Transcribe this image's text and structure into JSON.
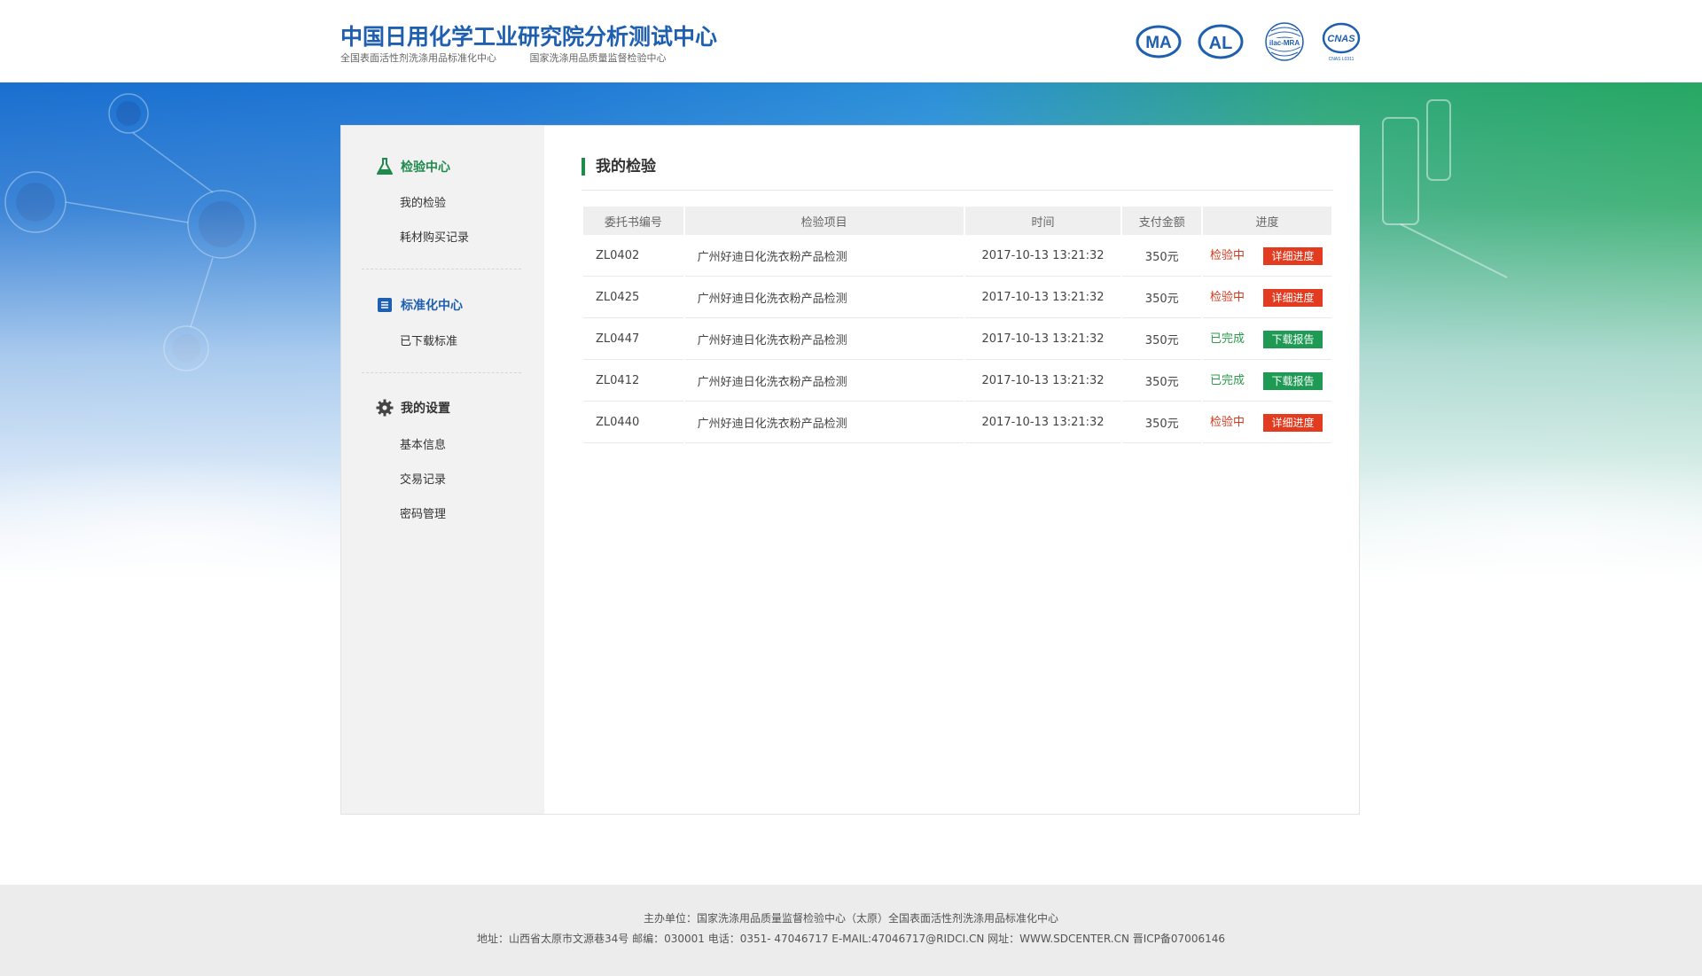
{
  "header": {
    "title": "中国日用化学工业研究院分析测试中心",
    "subtitles": [
      "全国表面活性剂洗涤用品标准化中心",
      "国家洗涤用品质量监督检验中心"
    ],
    "certs": [
      {
        "name": "cma",
        "text": "MA"
      },
      {
        "name": "cal",
        "text": "AL"
      },
      {
        "name": "ilac-mra",
        "text": "ilac-MRA"
      },
      {
        "name": "cnas",
        "text": "CNAS",
        "sub": "CNAS L0311"
      }
    ]
  },
  "sidebar": {
    "groups": [
      {
        "title": "检验中心",
        "icon": "flask-icon",
        "color": "#1e8a4b",
        "items": [
          "我的检验",
          "耗材购买记录"
        ]
      },
      {
        "title": "标准化中心",
        "icon": "document-icon",
        "color": "#1f5fb0",
        "items": [
          "已下载标准"
        ]
      },
      {
        "title": "我的设置",
        "icon": "gear-icon",
        "color": "#333333",
        "items": [
          "基本信息",
          "交易记录",
          "密码管理"
        ]
      }
    ]
  },
  "main": {
    "title": "我的检验",
    "columns": [
      "委托书编号",
      "检验项目",
      "时间",
      "支付金额",
      "进度"
    ],
    "rows": [
      {
        "no": "ZL0402",
        "item": "广州好迪日化洗衣粉产品检测",
        "time": "2017-10-13  13:21:32",
        "amount": "350元",
        "status": "检验中",
        "state": "doing",
        "action": "详细进度"
      },
      {
        "no": "ZL0425",
        "item": "广州好迪日化洗衣粉产品检测",
        "time": "2017-10-13  13:21:32",
        "amount": "350元",
        "status": "检验中",
        "state": "doing",
        "action": "详细进度"
      },
      {
        "no": "ZL0447",
        "item": "广州好迪日化洗衣粉产品检测",
        "time": "2017-10-13  13:21:32",
        "amount": "350元",
        "status": "已完成",
        "state": "done",
        "action": "下载报告"
      },
      {
        "no": "ZL0412",
        "item": "广州好迪日化洗衣粉产品检测",
        "time": "2017-10-13  13:21:32",
        "amount": "350元",
        "status": "已完成",
        "state": "done",
        "action": "下载报告"
      },
      {
        "no": "ZL0440",
        "item": "广州好迪日化洗衣粉产品检测",
        "time": "2017-10-13  13:21:32",
        "amount": "350元",
        "status": "检验中",
        "state": "doing",
        "action": "详细进度"
      }
    ]
  },
  "footer": {
    "line1": "主办单位：国家洗涤用品质量监督检验中心（太原）全国表面活性剂洗涤用品标准化中心",
    "line2": "地址：山西省太原市文源巷34号   邮编：030001   电话：0351- 47046717    E-MAIL:47046717@RIDCI.CN   网址：WWW.SDCENTER.CN   晋ICP备07006146"
  },
  "colors": {
    "brand_blue": "#1f5fb0",
    "accent_green": "#1e8a4b",
    "status_doing": "#d03a1e",
    "status_done": "#2b9a4a",
    "btn_red": "#e23b1f",
    "btn_green": "#1f9a54"
  }
}
